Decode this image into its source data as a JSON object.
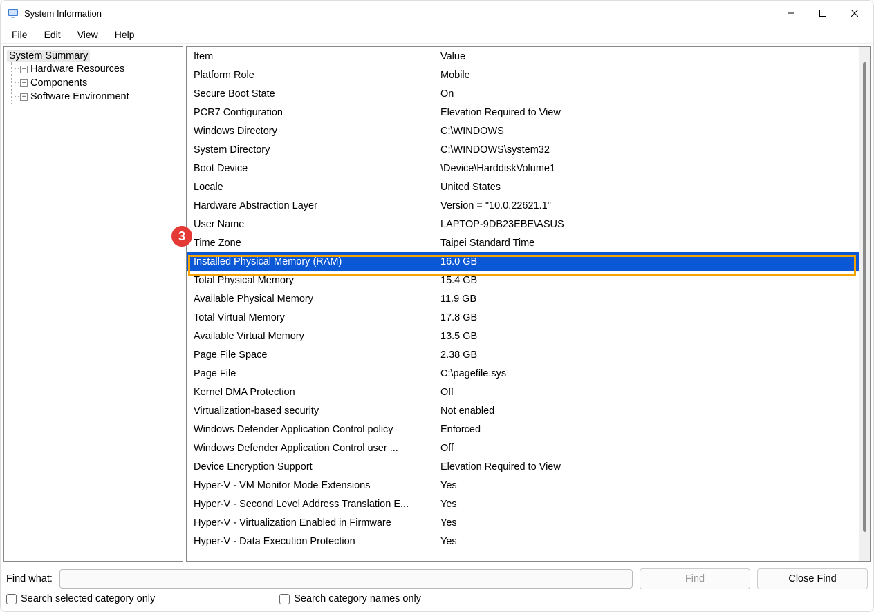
{
  "window": {
    "title": "System Information"
  },
  "menubar": [
    "File",
    "Edit",
    "View",
    "Help"
  ],
  "tree": {
    "root": "System Summary",
    "children": [
      "Hardware Resources",
      "Components",
      "Software Environment"
    ]
  },
  "columns": {
    "item": "Item",
    "value": "Value"
  },
  "rows": [
    {
      "item": "Platform Role",
      "value": "Mobile"
    },
    {
      "item": "Secure Boot State",
      "value": "On"
    },
    {
      "item": "PCR7 Configuration",
      "value": "Elevation Required to View"
    },
    {
      "item": "Windows Directory",
      "value": "C:\\WINDOWS"
    },
    {
      "item": "System Directory",
      "value": "C:\\WINDOWS\\system32"
    },
    {
      "item": "Boot Device",
      "value": "\\Device\\HarddiskVolume1"
    },
    {
      "item": "Locale",
      "value": "United States"
    },
    {
      "item": "Hardware Abstraction Layer",
      "value": "Version = \"10.0.22621.1\""
    },
    {
      "item": "User Name",
      "value": "LAPTOP-9DB23EBE\\ASUS"
    },
    {
      "item": "Time Zone",
      "value": "Taipei Standard Time"
    },
    {
      "item": "Installed Physical Memory (RAM)",
      "value": "16.0 GB",
      "selected": true
    },
    {
      "item": "Total Physical Memory",
      "value": "15.4 GB"
    },
    {
      "item": "Available Physical Memory",
      "value": "11.9 GB"
    },
    {
      "item": "Total Virtual Memory",
      "value": "17.8 GB"
    },
    {
      "item": "Available Virtual Memory",
      "value": "13.5 GB"
    },
    {
      "item": "Page File Space",
      "value": "2.38 GB"
    },
    {
      "item": "Page File",
      "value": "C:\\pagefile.sys"
    },
    {
      "item": "Kernel DMA Protection",
      "value": "Off"
    },
    {
      "item": "Virtualization-based security",
      "value": "Not enabled"
    },
    {
      "item": "Windows Defender Application Control policy",
      "value": "Enforced"
    },
    {
      "item": "Windows Defender Application Control user ...",
      "value": "Off"
    },
    {
      "item": "Device Encryption Support",
      "value": "Elevation Required to View"
    },
    {
      "item": "Hyper-V - VM Monitor Mode Extensions",
      "value": "Yes"
    },
    {
      "item": "Hyper-V - Second Level Address Translation E...",
      "value": "Yes"
    },
    {
      "item": "Hyper-V - Virtualization Enabled in Firmware",
      "value": "Yes"
    },
    {
      "item": "Hyper-V - Data Execution Protection",
      "value": "Yes"
    }
  ],
  "find": {
    "label": "Find what:",
    "find_btn": "Find",
    "close_btn": "Close Find",
    "check1": "Search selected category only",
    "check2": "Search category names only"
  },
  "annotation": {
    "badge": "3"
  }
}
